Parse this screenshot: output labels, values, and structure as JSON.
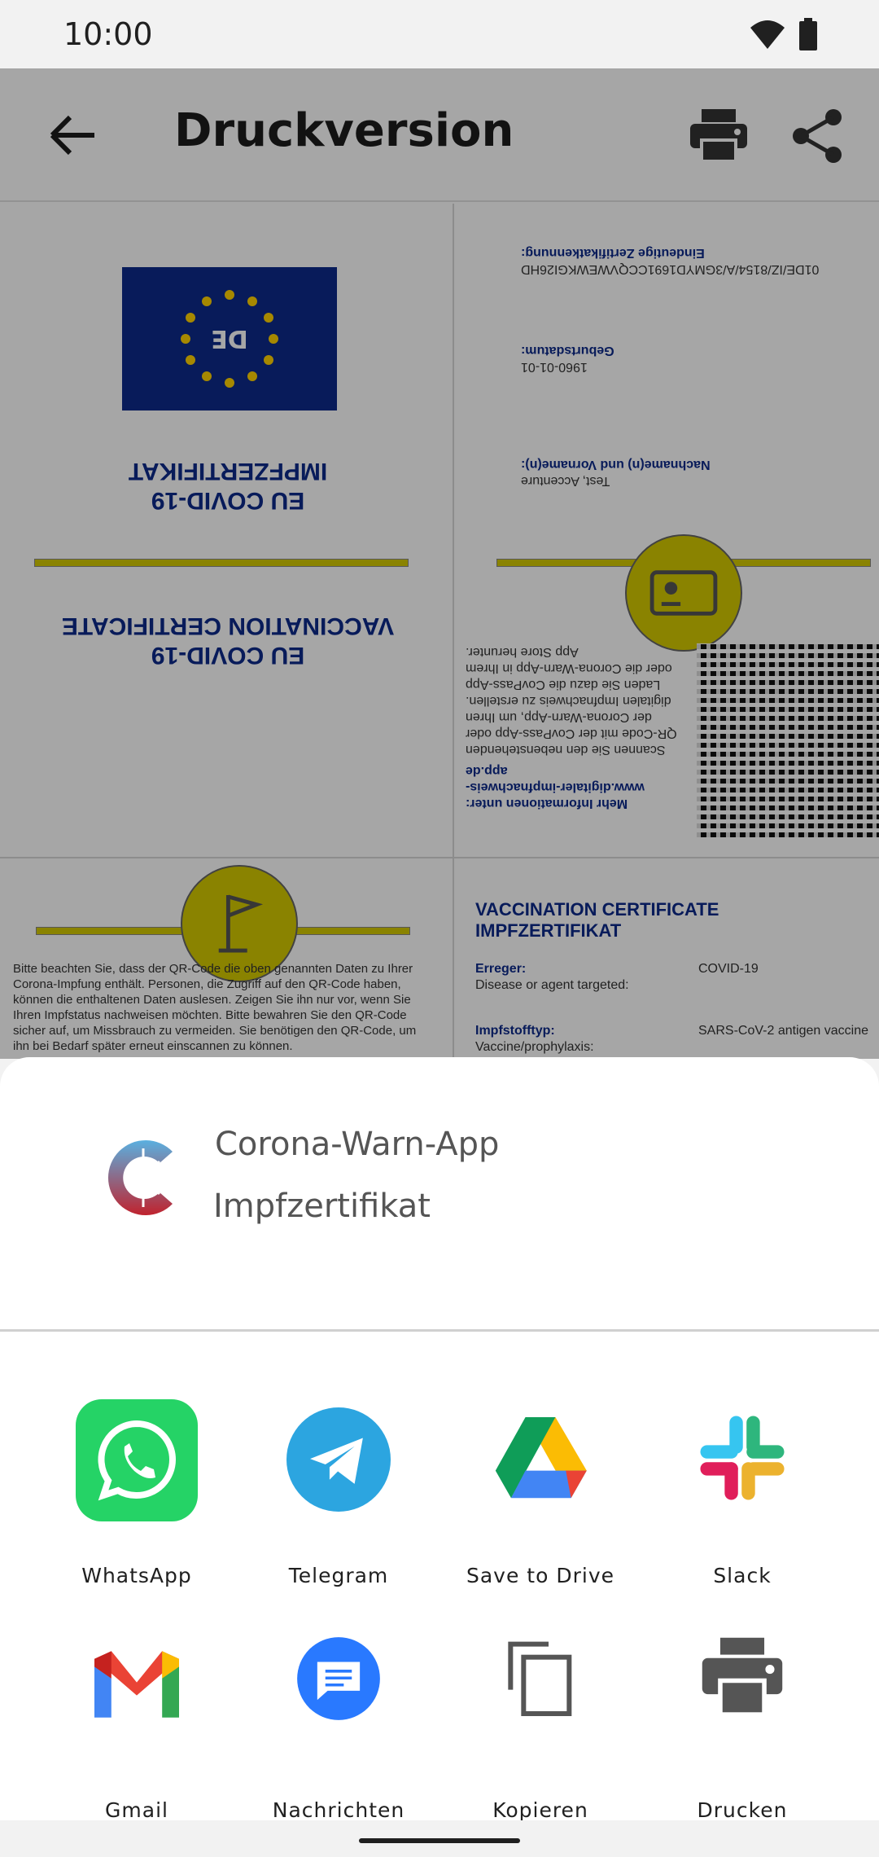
{
  "status_bar": {
    "time": "10:00"
  },
  "app": {
    "title": "Druckversion",
    "document": {
      "flag_text": "DE",
      "upside_title_1": "EU COVID-19\nIMPFZERTIFIKAT",
      "upside_title_2": "EU COVID-19\nVACCINATION CERTIFICATE",
      "upside_id_label": "Eindeutige Zertifikatkennung:",
      "upside_id_value": "01DE/IZ/8154/A/3GMYD1691CCQVWEWKGI26HD",
      "upside_birth_label": "Geburtsdatum:",
      "upside_birth_value": "1960-01-01",
      "upside_name_label": "Nachname(n) und Vorname(n):",
      "upside_name_value": "Test, Accenture",
      "upside_info_text": "Scannen Sie den nebenstehenden QR-Code mit der CovPass-App oder der Corona-Warn-App, um Ihren digitalen Impfnachweis zu erstellen. Laden Sie dazu die CovPass-App oder die Corona-Warn-App in Ihrem App Store herunter.",
      "upside_more_info": "Mehr Informationen unter: www.digitaler-impfnachweis-app.de",
      "notice_text": "Bitte beachten Sie, dass der QR-Code die oben genannten Daten zu Ihrer Corona-Impfung enthält. Personen, die Zugriff auf den QR-Code haben, können die enthaltenen Daten auslesen. Zeigen Sie ihn nur vor, wenn Sie Ihren Impfstatus nachweisen möchten. Bitte bewahren Sie den QR-Code sicher auf, um Missbrauch zu vermeiden. Sie benötigen den QR-Code, um ihn bei Bedarf später erneut einscannen zu können.",
      "vc_title": "VACCINATION CERTIFICATE\nIMPFZERTIFIKAT",
      "rows": [
        {
          "label": "Erreger:",
          "sub": "Disease or agent targeted:",
          "value": "COVID-19"
        },
        {
          "label": "Impfstofftyp:",
          "sub": "Vaccine/prophylaxis:",
          "value": "SARS-CoV-2 antigen vaccine"
        }
      ]
    }
  },
  "share_sheet": {
    "app_name": "Corona-Warn-App",
    "subtitle": "Impfzertifikat",
    "targets": [
      {
        "label": "WhatsApp",
        "icon": "whatsapp-icon"
      },
      {
        "label": "Telegram",
        "icon": "telegram-icon"
      },
      {
        "label": "Save to Drive",
        "icon": "google-drive-icon"
      },
      {
        "label": "Slack",
        "icon": "slack-icon"
      },
      {
        "label": "Gmail",
        "icon": "gmail-icon"
      },
      {
        "label": "Nachrichten",
        "icon": "messages-icon"
      },
      {
        "label": "Kopieren",
        "icon": "copy-icon"
      },
      {
        "label": "Drucken",
        "icon": "print-icon"
      }
    ]
  },
  "colors": {
    "eu_blue": "#0d2a8a",
    "accent_yellow": "#d4c900",
    "whatsapp_green": "#25d366",
    "telegram_blue": "#2ca5e0"
  }
}
